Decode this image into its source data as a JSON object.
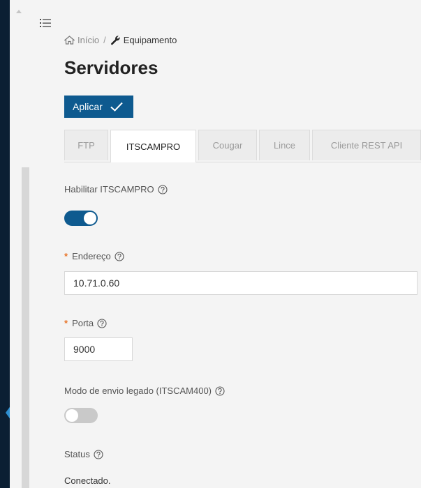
{
  "breadcrumb": {
    "home": "Início",
    "separator": "/",
    "current": "Equipamento"
  },
  "page": {
    "title": "Servidores"
  },
  "toolbar": {
    "apply_label": "Aplicar"
  },
  "tabs": [
    {
      "label": "FTP",
      "active": false
    },
    {
      "label": "ITSCAMPRO",
      "active": true
    },
    {
      "label": "Cougar",
      "active": false
    },
    {
      "label": "Lince",
      "active": false
    },
    {
      "label": "Cliente REST API",
      "active": false
    }
  ],
  "form": {
    "enable": {
      "label": "Habilitar ITSCAMPRO",
      "on": true
    },
    "address": {
      "label": "Endereço",
      "required_mark": "*",
      "value": "10.71.0.60"
    },
    "port": {
      "label": "Porta",
      "required_mark": "*",
      "value": "9000"
    },
    "legacy": {
      "label": "Modo de envio legado (ITSCAM400)",
      "on": false
    },
    "status": {
      "label": "Status",
      "value": "Conectado."
    }
  },
  "colors": {
    "accent": "#0e5a8f",
    "required": "#e8762c",
    "sidebar": "#0b1f33"
  },
  "icons": [
    "menu-icon",
    "home-icon",
    "wrench-icon",
    "checkmark-icon",
    "help-icon"
  ]
}
